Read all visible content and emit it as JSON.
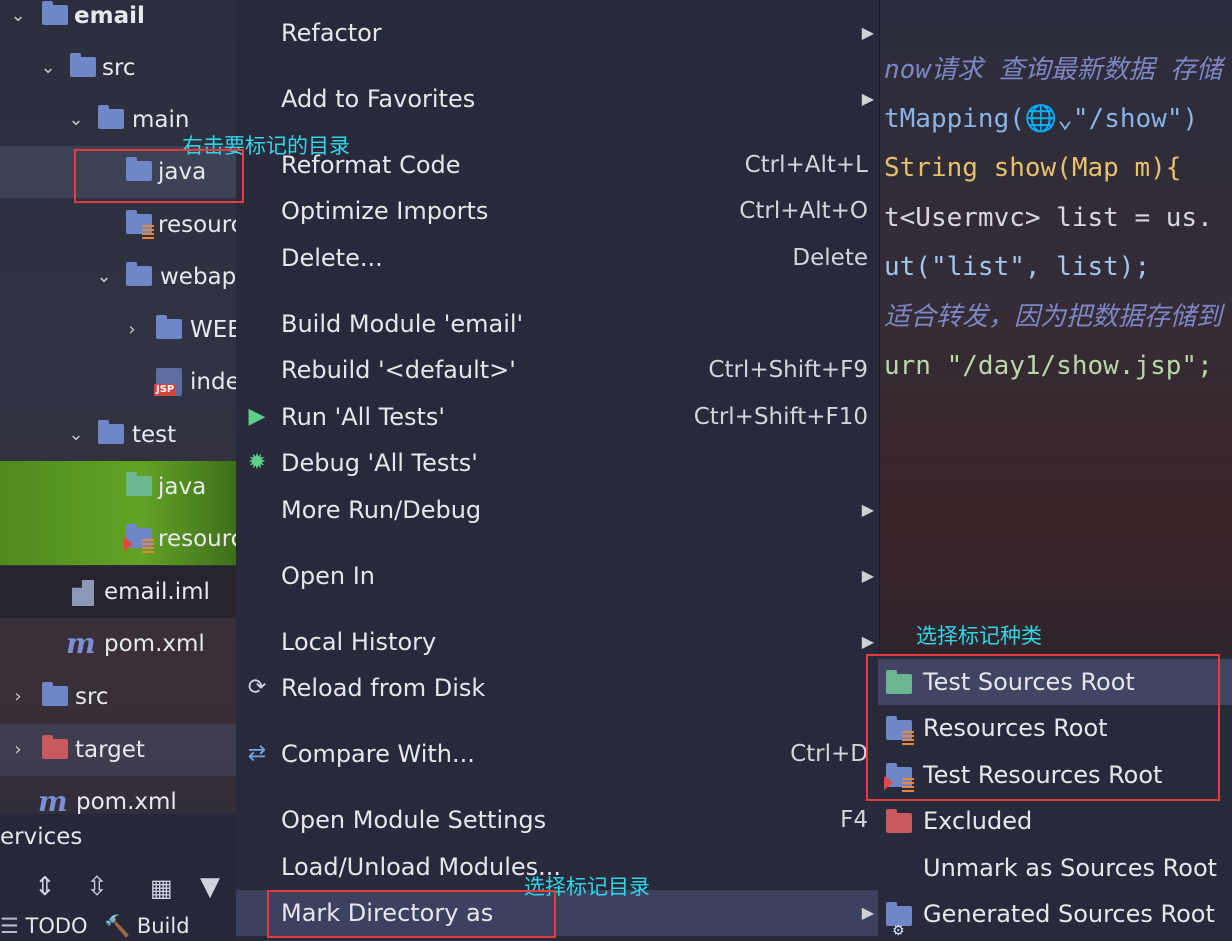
{
  "project_tree": {
    "rows": [
      {
        "label": "email",
        "chevron": "⌄",
        "icon": "module-folder-icon"
      },
      {
        "label": "src",
        "chevron": "⌄",
        "icon": "folder-icon"
      },
      {
        "label": "main",
        "chevron": "⌄",
        "icon": "folder-icon"
      },
      {
        "label": "java",
        "chevron": "",
        "icon": "source-folder-icon"
      },
      {
        "label": "resources",
        "chevron": "",
        "icon": "resources-folder-icon"
      },
      {
        "label": "webapp",
        "chevron": "⌄",
        "icon": "web-folder-icon"
      },
      {
        "label": "WEB-INF",
        "chevron": "›",
        "icon": "folder-icon"
      },
      {
        "label": "index.jsp",
        "chevron": "",
        "icon": "jsp-file-icon"
      },
      {
        "label": "test",
        "chevron": "⌄",
        "icon": "folder-icon"
      },
      {
        "label": "java",
        "chevron": "",
        "icon": "test-source-folder-icon"
      },
      {
        "label": "resources",
        "chevron": "",
        "icon": "test-resources-folder-icon"
      },
      {
        "label": "email.iml",
        "chevron": "",
        "icon": "iml-file-icon"
      },
      {
        "label": "pom.xml",
        "chevron": "",
        "icon": "maven-icon"
      },
      {
        "label": "src",
        "chevron": "›",
        "icon": "folder-icon"
      },
      {
        "label": "target",
        "chevron": "›",
        "icon": "excluded-folder-icon"
      },
      {
        "label": "pom.xml",
        "chevron": "",
        "icon": "maven-icon"
      }
    ],
    "services_label": "ervices",
    "bottom_tabs": {
      "todo": "TODO",
      "build": "Build"
    }
  },
  "editor": {
    "lines": [
      {
        "text": "now请求 查询最新数据 存储",
        "color": "#7f86c4",
        "italic": true
      },
      {
        "text": "tMapping(🌐⌄\"/show\")",
        "color": "#8ab4e8",
        "italic": false
      },
      {
        "text": "String show(Map m){",
        "color": "#e8c06a",
        "italic": false
      },
      {
        "text": "t<Usermvc> list = us.",
        "color": "#d8d8e0",
        "italic": false
      },
      {
        "text": "ut(\"list\", list);",
        "color": "#9fc7f0",
        "italic": false
      },
      {
        "text": "适合转发，因为把数据存储到",
        "color": "#7f86c4",
        "italic": true
      },
      {
        "text": "urn \"/day1/show.jsp\";",
        "color": "#b8d8a8",
        "italic": false
      }
    ]
  },
  "context_menu": {
    "items": [
      {
        "label": "Refactor",
        "shortcut": "",
        "submenu": true,
        "icon": ""
      },
      {
        "label": "Add to Favorites",
        "shortcut": "",
        "submenu": true,
        "icon": ""
      },
      {
        "label": "Reformat Code",
        "shortcut": "Ctrl+Alt+L",
        "submenu": false,
        "icon": ""
      },
      {
        "label": "Optimize Imports",
        "shortcut": "Ctrl+Alt+O",
        "submenu": false,
        "icon": ""
      },
      {
        "label": "Delete...",
        "shortcut": "Delete",
        "submenu": false,
        "icon": ""
      },
      {
        "label": "Build Module 'email'",
        "shortcut": "",
        "submenu": false,
        "icon": ""
      },
      {
        "label": "Rebuild '<default>'",
        "shortcut": "Ctrl+Shift+F9",
        "submenu": false,
        "icon": ""
      },
      {
        "label": "Run 'All Tests'",
        "shortcut": "Ctrl+Shift+F10",
        "submenu": false,
        "icon": "run-icon"
      },
      {
        "label": "Debug 'All Tests'",
        "shortcut": "",
        "submenu": false,
        "icon": "debug-icon"
      },
      {
        "label": "More Run/Debug",
        "shortcut": "",
        "submenu": true,
        "icon": ""
      },
      {
        "label": "Open In",
        "shortcut": "",
        "submenu": true,
        "icon": ""
      },
      {
        "label": "Local History",
        "shortcut": "",
        "submenu": true,
        "icon": ""
      },
      {
        "label": "Reload from Disk",
        "shortcut": "",
        "submenu": false,
        "icon": "reload-icon"
      },
      {
        "label": "Compare With...",
        "shortcut": "Ctrl+D",
        "submenu": false,
        "icon": "compare-icon"
      },
      {
        "label": "Open Module Settings",
        "shortcut": "F4",
        "submenu": false,
        "icon": ""
      },
      {
        "label": "Load/Unload Modules...",
        "shortcut": "",
        "submenu": false,
        "icon": ""
      },
      {
        "label": "Mark Directory as",
        "shortcut": "",
        "submenu": true,
        "icon": ""
      }
    ]
  },
  "mark_submenu": {
    "items": [
      {
        "label": "Test Sources Root",
        "icon": "test-sources-root-icon"
      },
      {
        "label": "Resources Root",
        "icon": "resources-root-icon"
      },
      {
        "label": "Test Resources Root",
        "icon": "test-resources-root-icon"
      },
      {
        "label": "Excluded",
        "icon": "excluded-folder-icon"
      },
      {
        "label": "Unmark as Sources Root",
        "icon": ""
      },
      {
        "label": "Generated Sources Root",
        "icon": "generated-sources-root-icon"
      }
    ]
  },
  "annotations": {
    "right_click_target": "右击要标记的目录",
    "choose_mark_dir": "选择标记目录",
    "choose_mark_type": "选择标记种类"
  },
  "colors": {
    "accent_annotation": "#2fd6e6",
    "highlight_box": "#e23c3c",
    "menu_bg": "#282a3b",
    "selection": "#3c4160"
  }
}
